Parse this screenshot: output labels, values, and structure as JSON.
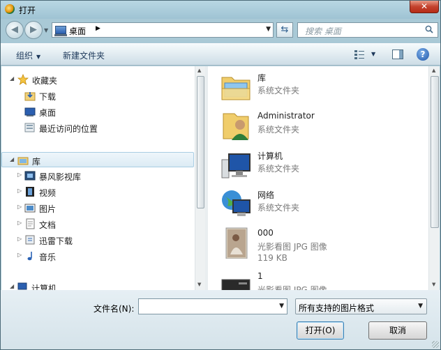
{
  "window": {
    "title": "打开"
  },
  "address": {
    "location": "桌面",
    "separator": "▶"
  },
  "search": {
    "placeholder": "搜索 桌面"
  },
  "toolbar": {
    "organize": "组织",
    "new_folder": "新建文件夹"
  },
  "nav_tree": [
    {
      "label": "收藏夹",
      "icon": "star-icon",
      "expanded": true
    },
    {
      "label": "下载",
      "icon": "download-folder-icon"
    },
    {
      "label": "桌面",
      "icon": "desktop-icon"
    },
    {
      "label": "最近访问的位置",
      "icon": "recent-places-icon"
    },
    {
      "label": "库",
      "icon": "library-icon",
      "expanded": true,
      "selected": true
    },
    {
      "label": "暴风影视库",
      "icon": "media-library-icon"
    },
    {
      "label": "视频",
      "icon": "video-library-icon"
    },
    {
      "label": "图片",
      "icon": "pictures-library-icon"
    },
    {
      "label": "文档",
      "icon": "documents-library-icon"
    },
    {
      "label": "迅雷下载",
      "icon": "thunder-download-icon"
    },
    {
      "label": "音乐",
      "icon": "music-library-icon"
    },
    {
      "label": "计算机",
      "icon": "computer-icon"
    }
  ],
  "files": [
    {
      "name": "库",
      "type": "系统文件夹",
      "size": "",
      "icon": "library-folder-icon"
    },
    {
      "name": "Administrator",
      "type": "系统文件夹",
      "size": "",
      "icon": "user-folder-icon"
    },
    {
      "name": "计算机",
      "type": "系统文件夹",
      "size": "",
      "icon": "computer-icon"
    },
    {
      "name": "网络",
      "type": "系统文件夹",
      "size": "",
      "icon": "network-icon"
    },
    {
      "name": "000",
      "type": "光影看图 JPG 图像",
      "size": "119 KB",
      "icon": "image-thumbnail-icon"
    },
    {
      "name": "1",
      "type": "光影看图 JPG 图像",
      "size": "",
      "icon": "image-thumbnail-icon"
    }
  ],
  "bottom": {
    "filename_label": "文件名(N):",
    "filename_value": "",
    "filter": "所有支持的图片格式",
    "open_label": "打开(O)",
    "cancel_label": "取消"
  },
  "colors": {
    "frame": "#a9c9d6",
    "selection": "#dcebf4",
    "close_button": "#c4422d"
  }
}
